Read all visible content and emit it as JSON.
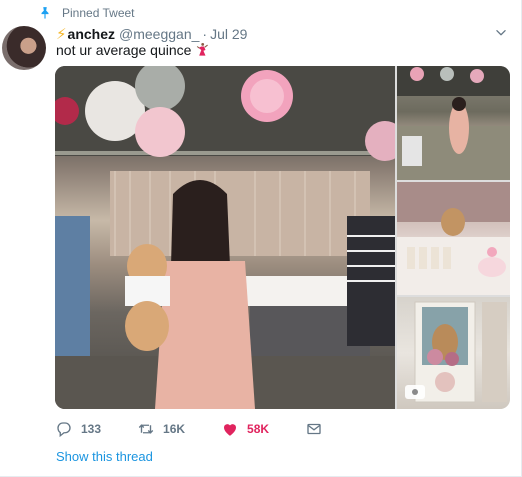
{
  "pinned": {
    "label": "Pinned Tweet"
  },
  "author": {
    "display_name": "anchez",
    "name_emoji": "⚡",
    "handle": "@meeggan_",
    "time": "Jul 29"
  },
  "tweet": {
    "text": "not ur average quince"
  },
  "media": {
    "count": 4,
    "gif_badge": ""
  },
  "actions": {
    "replies": "133",
    "retweets": "16K",
    "likes": "58K"
  },
  "show_thread": "Show this thread",
  "colors": {
    "like": "#e0245e",
    "link": "#1b95e0",
    "muted": "#657786"
  }
}
